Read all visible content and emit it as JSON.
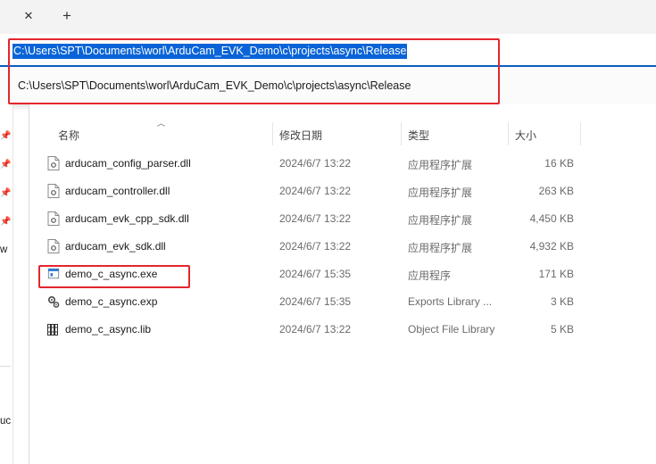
{
  "tabstrip": {
    "close_glyph": "✕",
    "new_tab_glyph": "+"
  },
  "address_bar": {
    "value": "C:\\Users\\SPT\\Documents\\worl\\ArduCam_EVK_Demo\\c\\projects\\async\\Release"
  },
  "suggestion": {
    "text": "C:\\Users\\SPT\\Documents\\worl\\ArduCam_EVK_Demo\\c\\projects\\async\\Release"
  },
  "nav": {
    "fragment_1": "w",
    "fragment_2": "uc"
  },
  "columns": {
    "name": "名称",
    "date": "修改日期",
    "type": "类型",
    "size": "大小"
  },
  "files": [
    {
      "name": "arducam_config_parser.dll",
      "date": "2024/6/7 13:22",
      "type": "应用程序扩展",
      "size": "16 KB",
      "icon": "dll-file-icon"
    },
    {
      "name": "arducam_controller.dll",
      "date": "2024/6/7 13:22",
      "type": "应用程序扩展",
      "size": "263 KB",
      "icon": "dll-file-icon"
    },
    {
      "name": "arducam_evk_cpp_sdk.dll",
      "date": "2024/6/7 13:22",
      "type": "应用程序扩展",
      "size": "4,450 KB",
      "icon": "dll-file-icon"
    },
    {
      "name": "arducam_evk_sdk.dll",
      "date": "2024/6/7 13:22",
      "type": "应用程序扩展",
      "size": "4,932 KB",
      "icon": "dll-file-icon"
    },
    {
      "name": "demo_c_async.exe",
      "date": "2024/6/7 15:35",
      "type": "应用程序",
      "size": "171 KB",
      "icon": "exe-file-icon"
    },
    {
      "name": "demo_c_async.exp",
      "date": "2024/6/7 15:35",
      "type": "Exports Library ...",
      "size": "3 KB",
      "icon": "exp-file-icon"
    },
    {
      "name": "demo_c_async.lib",
      "date": "2024/6/7 13:22",
      "type": "Object File Library",
      "size": "5 KB",
      "icon": "lib-file-icon"
    }
  ],
  "colors": {
    "selection": "#0a64d7",
    "highlight_box": "#e3262c",
    "focus_underline": "#0a5fc8"
  }
}
